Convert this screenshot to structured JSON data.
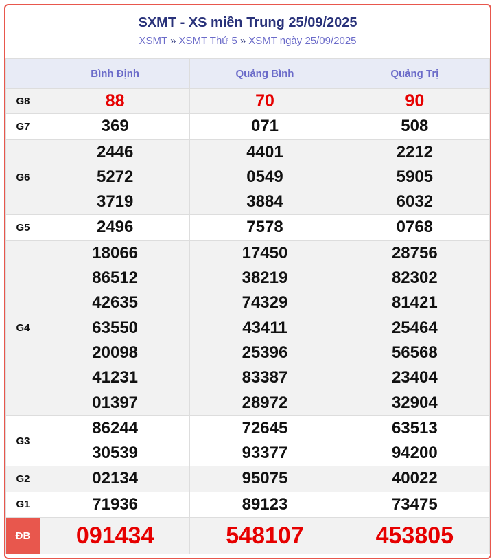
{
  "header": {
    "title": "SXMT - XS miền Trung 25/09/2025",
    "crumbs": [
      "XSMT",
      "XSMT Thứ 5",
      "XSMT ngày 25/09/2025"
    ],
    "separator": "»"
  },
  "colors": {
    "accent_red": "#e8574d",
    "number_red": "#e60000",
    "title_blue": "#29327a",
    "link_purple": "#6b6bc9",
    "header_row_bg": "#e8ebf6"
  },
  "provinces": [
    "Bình Định",
    "Quảng Bình",
    "Quảng Trị"
  ],
  "prizes": [
    {
      "label": "G8",
      "values": [
        [
          "88"
        ],
        [
          "70"
        ],
        [
          "90"
        ]
      ]
    },
    {
      "label": "G7",
      "values": [
        [
          "369"
        ],
        [
          "071"
        ],
        [
          "508"
        ]
      ]
    },
    {
      "label": "G6",
      "values": [
        [
          "2446",
          "5272",
          "3719"
        ],
        [
          "4401",
          "0549",
          "3884"
        ],
        [
          "2212",
          "5905",
          "6032"
        ]
      ]
    },
    {
      "label": "G5",
      "values": [
        [
          "2496"
        ],
        [
          "7578"
        ],
        [
          "0768"
        ]
      ]
    },
    {
      "label": "G4",
      "values": [
        [
          "18066",
          "86512",
          "42635",
          "63550",
          "20098",
          "41231",
          "01397"
        ],
        [
          "17450",
          "38219",
          "74329",
          "43411",
          "25396",
          "83387",
          "28972"
        ],
        [
          "28756",
          "82302",
          "81421",
          "25464",
          "56568",
          "23404",
          "32904"
        ]
      ]
    },
    {
      "label": "G3",
      "values": [
        [
          "86244",
          "30539"
        ],
        [
          "72645",
          "93377"
        ],
        [
          "63513",
          "94200"
        ]
      ]
    },
    {
      "label": "G2",
      "values": [
        [
          "02134"
        ],
        [
          "95075"
        ],
        [
          "40022"
        ]
      ]
    },
    {
      "label": "G1",
      "values": [
        [
          "71936"
        ],
        [
          "89123"
        ],
        [
          "73475"
        ]
      ]
    },
    {
      "label": "ĐB",
      "values": [
        [
          "091434"
        ],
        [
          "548107"
        ],
        [
          "453805"
        ]
      ]
    }
  ]
}
